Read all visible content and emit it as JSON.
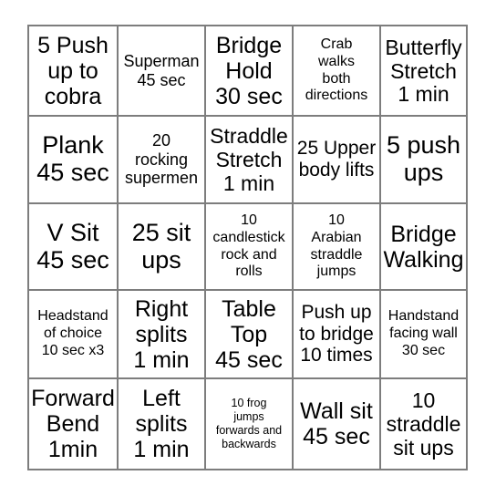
{
  "card": {
    "type": "bingo-card",
    "rows": 5,
    "columns": 5,
    "grid_line_color": "#7d7d7d",
    "background_color": "#ffffff",
    "text_color": "#000000",
    "cells": [
      [
        {
          "text": "5 Push\nup to\ncobra",
          "size": "xl"
        },
        {
          "text": "Superman\n45 sec",
          "size": "s"
        },
        {
          "text": "Bridge\nHold\n30 sec",
          "size": "xl"
        },
        {
          "text": "Crab\nwalks\nboth\ndirections",
          "size": "xs"
        },
        {
          "text": "Butterfly\nStretch\n1 min",
          "size": "l"
        }
      ],
      [
        {
          "text": "Plank\n45 sec",
          "size": "xxl"
        },
        {
          "text": "20\nrocking\nsupermen",
          "size": "s"
        },
        {
          "text": "Straddle\nStretch\n1 min",
          "size": "l"
        },
        {
          "text": "25 Upper\nbody lifts",
          "size": "m"
        },
        {
          "text": "5 push\nups",
          "size": "xxl"
        }
      ],
      [
        {
          "text": "V Sit\n45 sec",
          "size": "xxl"
        },
        {
          "text": "25 sit\nups",
          "size": "xxl"
        },
        {
          "text": "10\ncandlestick\nrock and\nrolls",
          "size": "xs"
        },
        {
          "text": "10\nArabian\nstraddle\njumps",
          "size": "xs"
        },
        {
          "text": "Bridge\nWalking",
          "size": "xl"
        }
      ],
      [
        {
          "text": "Headstand\nof choice\n10 sec x3",
          "size": "xs"
        },
        {
          "text": "Right\nsplits\n1 min",
          "size": "xl"
        },
        {
          "text": "Table\nTop\n45 sec",
          "size": "xl"
        },
        {
          "text": "Push up\nto bridge\n10 times",
          "size": "m"
        },
        {
          "text": "Handstand\nfacing wall\n30 sec",
          "size": "xs"
        }
      ],
      [
        {
          "text": "Forward\nBend\n1min",
          "size": "xl"
        },
        {
          "text": "Left\nsplits\n1 min",
          "size": "xl"
        },
        {
          "text": "10 frog\njumps\nforwards and\nbackwards",
          "size": "tiny"
        },
        {
          "text": "Wall sit\n45 sec",
          "size": "xl"
        },
        {
          "text": "10\nstraddle\nsit ups",
          "size": "l"
        }
      ]
    ]
  }
}
